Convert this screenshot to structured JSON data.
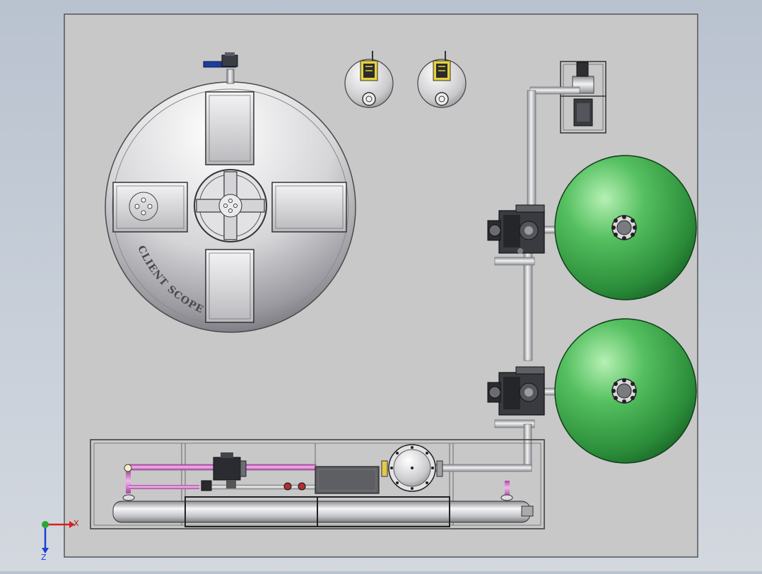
{
  "tank": {
    "label": "CLIENT SCOPE"
  },
  "triad": {
    "x_label": "X",
    "z_label": "Z"
  },
  "colors": {
    "viewport_top": "#b9c2cf",
    "base_plate": "#c8c8c8",
    "steel": "#d9dadd",
    "filter_green": "#39a048",
    "pink_pipe": "#d98ad6",
    "dark_frame": "#2a2a2a"
  }
}
